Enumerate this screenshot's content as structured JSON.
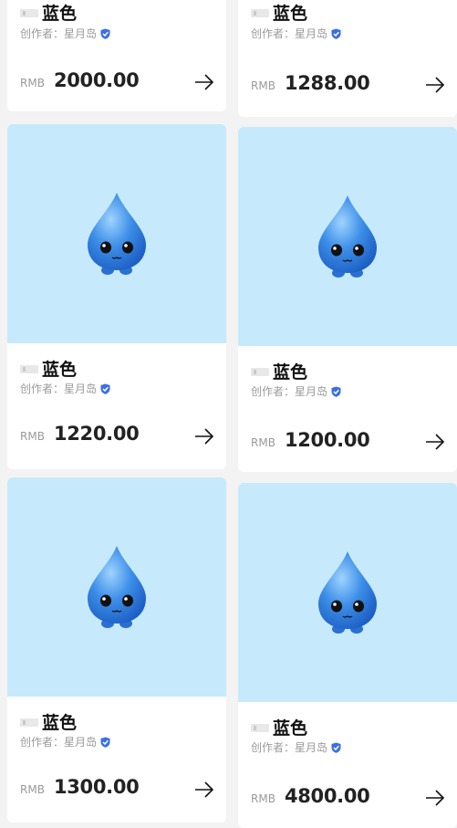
{
  "cards": [
    {
      "title": "蓝色",
      "creator_prefix": "创作者：",
      "creator": "星月岛",
      "currency": "RMB",
      "price": "2000.00"
    },
    {
      "title": "蓝色",
      "creator_prefix": "创作者：",
      "creator": "星月岛",
      "currency": "RMB",
      "price": "1288.00"
    },
    {
      "title": "蓝色",
      "creator_prefix": "创作者：",
      "creator": "星月岛",
      "currency": "RMB",
      "price": "1220.00"
    },
    {
      "title": "蓝色",
      "creator_prefix": "创作者：",
      "creator": "星月岛",
      "currency": "RMB",
      "price": "1200.00"
    },
    {
      "title": "蓝色",
      "creator_prefix": "创作者：",
      "creator": "星月岛",
      "currency": "RMB",
      "price": "1300.00"
    },
    {
      "title": "蓝色",
      "creator_prefix": "创作者：",
      "creator": "星月岛",
      "currency": "RMB",
      "price": "4800.00"
    }
  ],
  "colors": {
    "image_bg": "#c6eafb",
    "verified": "#3b6ee8",
    "text_muted": "#9a9a9a"
  },
  "icons": {
    "verified": "shield-check-icon",
    "go": "arrow-right-icon",
    "badge": "tag-icon"
  }
}
